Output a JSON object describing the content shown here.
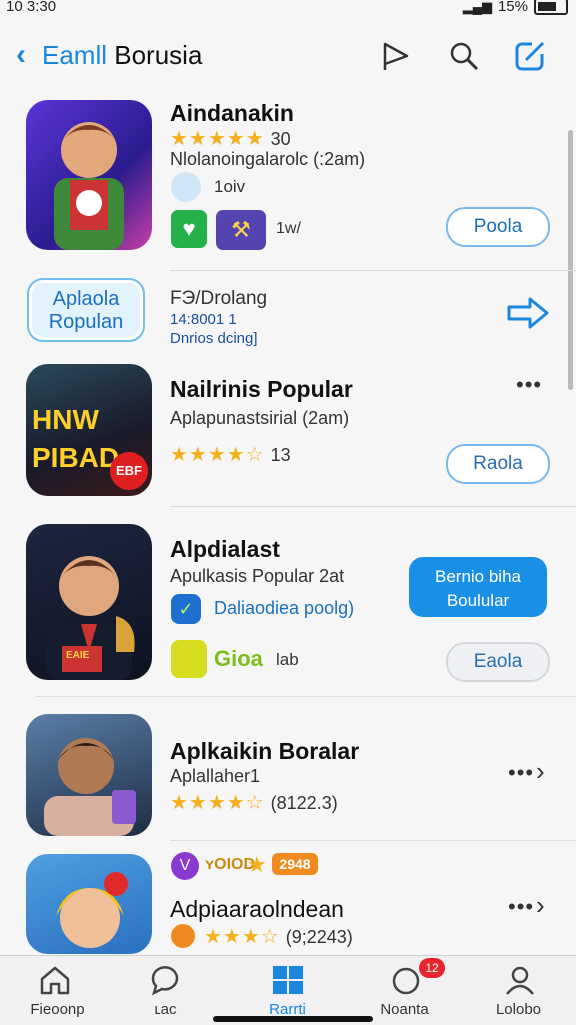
{
  "status_bar": {
    "time": "10 3:30",
    "battery": "15%"
  },
  "nav": {
    "back_label": "Eamll",
    "title": "Borusia"
  },
  "rows": {
    "r1": {
      "title": "Aindanakin",
      "rating": "30",
      "subtitle": "Nlolanoingalarolc (:2am)",
      "tag": "1oiv",
      "small_tag": "1w/",
      "button": "Poola"
    },
    "r2": {
      "badge_line1": "Aplaola",
      "badge_line2": "Ropulan",
      "line1": "FЭ/Drolang",
      "line2": "14:8001 1",
      "line3": "Dnrios dcing]"
    },
    "r3": {
      "title": "Nailrinis Popular",
      "subtitle": "Aplapunastsirial (2am)",
      "rating": "13",
      "button": "Raola",
      "icon_text1": "HNW",
      "icon_text2": "PIBAD",
      "icon_text3": "EBF"
    },
    "r4": {
      "title": "Alpdialast",
      "subtitle": "Apulkasis Popular 2at",
      "link": "Daliaodiea poolg)",
      "tag": "Gioa",
      "small_tag": "lab",
      "button_primary_1": "Bernio biha",
      "button_primary_2": "Boulular",
      "button_secondary": "Eaola",
      "icon_text": "EAIE"
    },
    "r5": {
      "title": "Aplkaikin Boralar",
      "subtitle": "Aplallaher1",
      "rating": "(8122.3)"
    },
    "r6": {
      "badge": "ʏOIOD",
      "badge2": "2948",
      "title": "Adpiaaraolndean",
      "rating": "(9;2243)"
    }
  },
  "tabs": [
    {
      "label": "Fieoonp"
    },
    {
      "label": "ʟac"
    },
    {
      "label": "Rarrti"
    },
    {
      "label": "Noanta",
      "badge": "12"
    },
    {
      "label": "Lolobo"
    }
  ],
  "colors": {
    "accent": "#1a86e0",
    "star": "#f2b01e",
    "badge": "#e8262c"
  }
}
